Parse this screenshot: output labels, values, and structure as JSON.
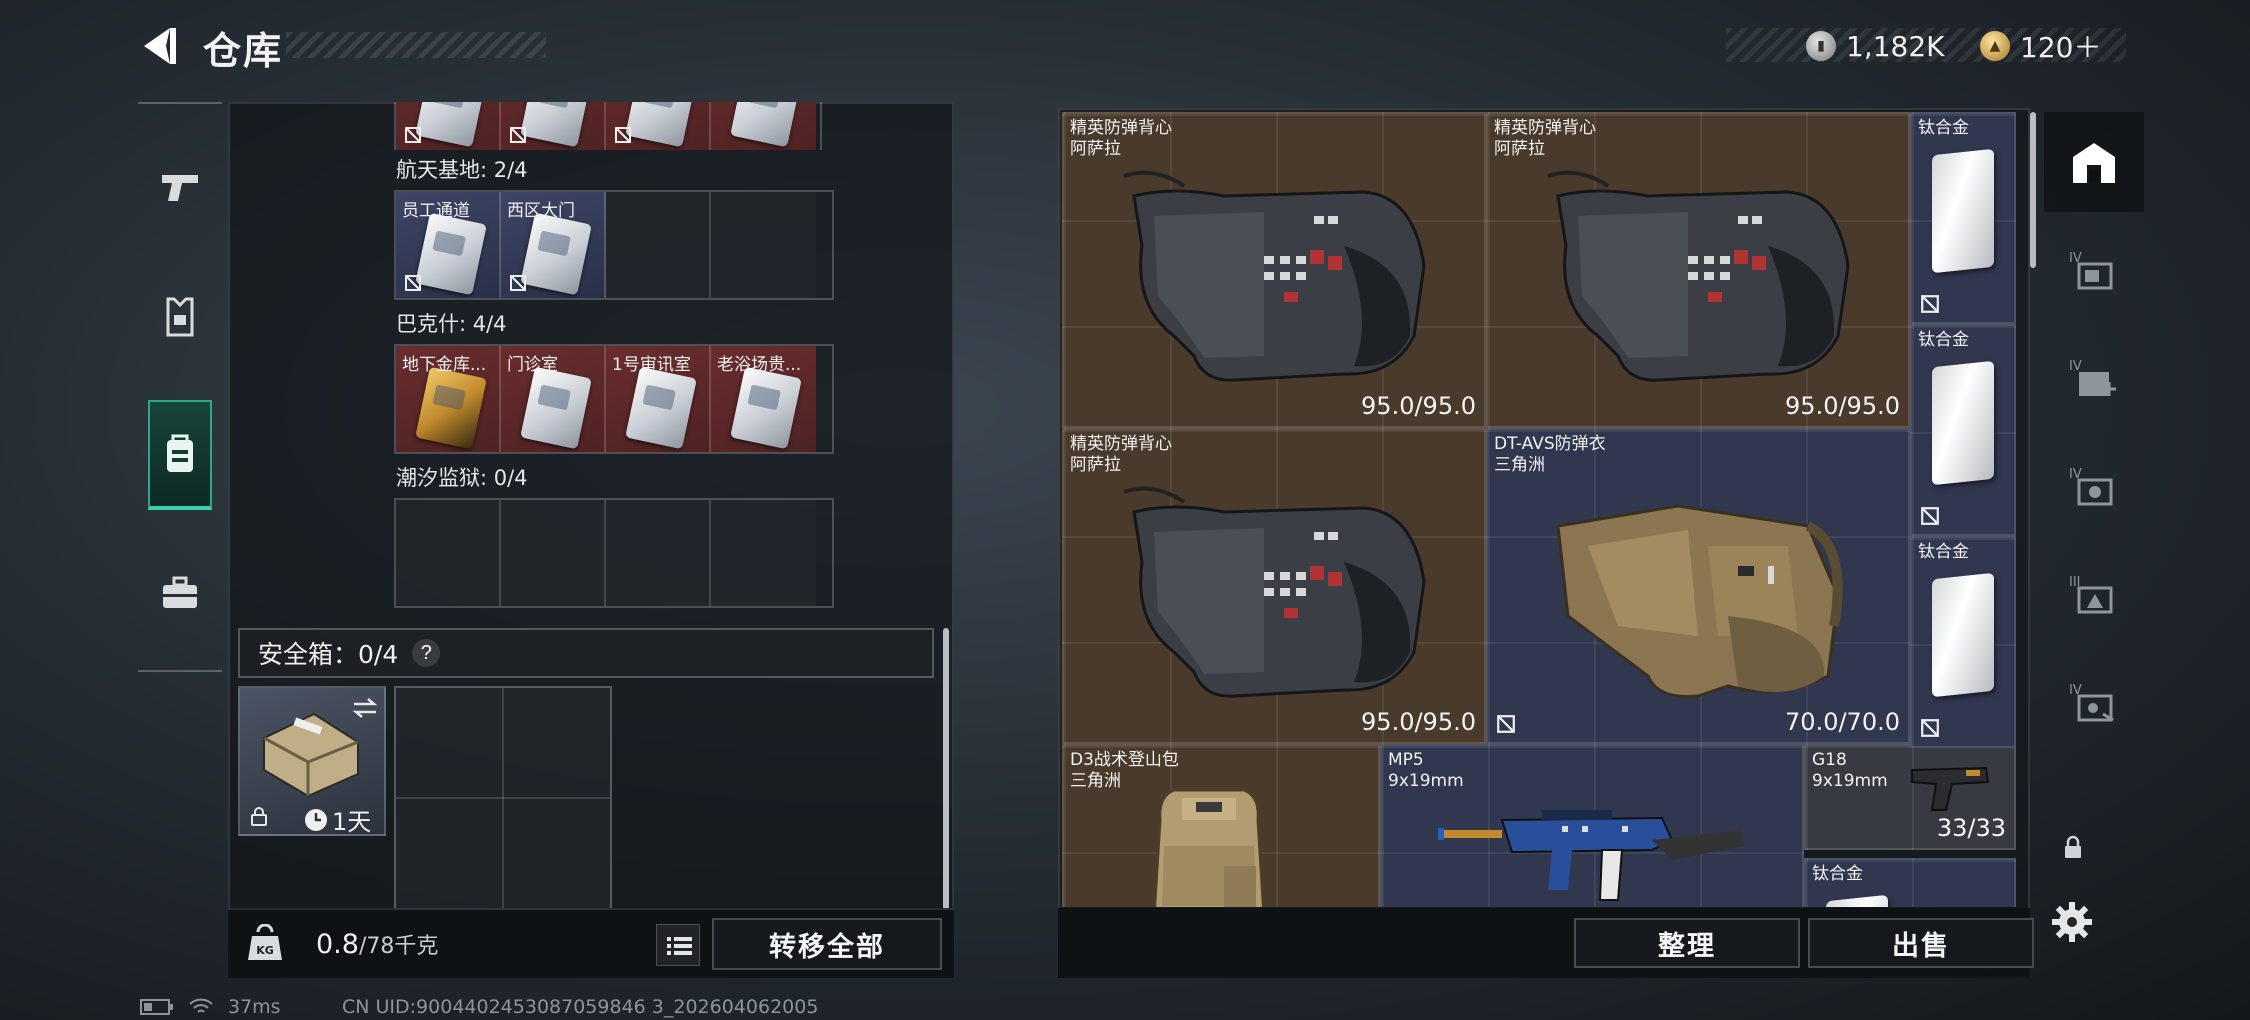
{
  "header": {
    "title": "仓库",
    "currencies": [
      {
        "icon": "silver-coin-icon",
        "value": "1,182K"
      },
      {
        "icon": "gold-coin-icon",
        "value": "120＋"
      }
    ]
  },
  "category_nav": [
    {
      "icon": "pistol-icon",
      "active": false
    },
    {
      "icon": "armor-icon",
      "active": false
    },
    {
      "icon": "backpack-icon",
      "active": true
    },
    {
      "icon": "briefcase-icon",
      "active": false
    }
  ],
  "keycard_sections": [
    {
      "label": "航天基地: 2/4",
      "cells": [
        {
          "name": "员工通道",
          "kind": "keycard",
          "color": "blue"
        },
        {
          "name": "西区大门",
          "kind": "keycard",
          "color": "blue"
        },
        {
          "name": "",
          "kind": "empty"
        },
        {
          "name": "",
          "kind": "empty"
        }
      ]
    },
    {
      "label": "巴克什: 4/4",
      "cells": [
        {
          "name": "地下金库...",
          "kind": "keycard-gold",
          "color": "red"
        },
        {
          "name": "门诊室",
          "kind": "keycard",
          "color": "red"
        },
        {
          "name": "1号审讯室",
          "kind": "keycard",
          "color": "red"
        },
        {
          "name": "老浴场贵...",
          "kind": "keycard",
          "color": "red"
        }
      ]
    },
    {
      "label": "潮汐监狱: 0/4",
      "cells": [
        {
          "name": "",
          "kind": "empty"
        },
        {
          "name": "",
          "kind": "empty"
        },
        {
          "name": "",
          "kind": "empty"
        },
        {
          "name": "",
          "kind": "empty"
        }
      ]
    }
  ],
  "safe_box": {
    "title": "安全箱：0/4",
    "help": "?",
    "duration": "1天",
    "swap_icon": "swap-arrows-icon"
  },
  "left_bottom": {
    "weight_icon_label": "KG",
    "weight_current": "0.8",
    "weight_max": "/78千克",
    "transfer_all": "转移全部"
  },
  "items": [
    {
      "id": "vest-1",
      "name": "精英防弹背心",
      "sub": "阿萨拉",
      "value": "95.0/95.0",
      "color": "brown",
      "art": "vest-dark"
    },
    {
      "id": "vest-2",
      "name": "精英防弹背心",
      "sub": "阿萨拉",
      "value": "95.0/95.0",
      "color": "brown",
      "art": "vest-dark"
    },
    {
      "id": "vest-3",
      "name": "精英防弹背心",
      "sub": "阿萨拉",
      "value": "95.0/95.0",
      "color": "brown",
      "art": "vest-dark"
    },
    {
      "id": "vest-4",
      "name": "DT-AVS防弹衣",
      "sub": "三角洲",
      "value": "70.0/70.0",
      "color": "navy",
      "art": "vest-tan"
    },
    {
      "id": "backpack",
      "name": "D3战术登山包",
      "sub": "三角洲",
      "value": "",
      "color": "brown",
      "art": "backpack"
    },
    {
      "id": "mp5",
      "name": "MP5",
      "sub": "9x19mm",
      "value": "",
      "color": "navy",
      "art": "smg"
    },
    {
      "id": "g18",
      "name": "G18",
      "sub": "9x19mm",
      "value": "33/33",
      "color": "gray",
      "art": "pistol"
    },
    {
      "id": "plate-1",
      "name": "钛合金",
      "sub": "",
      "value": "",
      "color": "navy",
      "art": "plate"
    },
    {
      "id": "plate-2",
      "name": "钛合金",
      "sub": "",
      "value": "",
      "color": "navy",
      "art": "plate"
    },
    {
      "id": "plate-3",
      "name": "钛合金",
      "sub": "",
      "value": "",
      "color": "navy",
      "art": "plate"
    },
    {
      "id": "plate-4",
      "name": "钛合金",
      "sub": "",
      "value": "",
      "color": "navy",
      "art": "plate"
    }
  ],
  "right_bottom": {
    "sort": "整理",
    "sell": "出售"
  },
  "side_nav": [
    {
      "icon": "stash-icon",
      "active": true
    },
    {
      "icon": "container-iv-icon",
      "active": false
    },
    {
      "icon": "container-iv-add-icon",
      "active": false
    },
    {
      "icon": "container-iv-camera-icon",
      "active": false
    },
    {
      "icon": "container-iii-icon",
      "active": false
    },
    {
      "icon": "container-iv-alt-icon",
      "active": false
    }
  ],
  "status_bar": {
    "ping": "37ms",
    "uid": "CN UID:9004402453087059846 3_202604062005"
  },
  "colors": {
    "accent": "#36d1a6",
    "item_brown": "#4a3a2c",
    "item_navy": "#30374f",
    "item_red": "#6a2d2e"
  }
}
